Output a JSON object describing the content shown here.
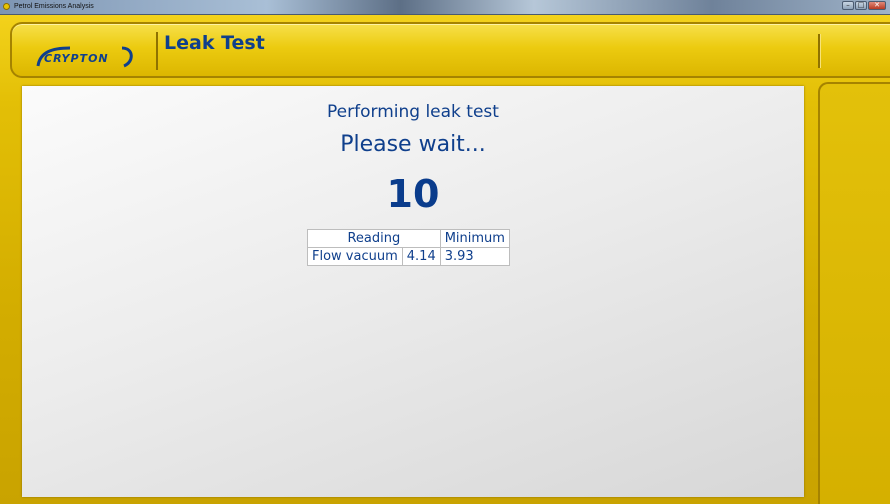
{
  "window": {
    "title": "Petrol Emissions Analysis",
    "controls": {
      "minimize": "–",
      "maximize": "□",
      "close": "✕"
    }
  },
  "header": {
    "logo_text": "CRYPTON",
    "title": "Leak Test"
  },
  "main": {
    "status_line_1": "Performing leak test",
    "status_line_2": "Please wait...",
    "countdown": "10",
    "table": {
      "headers": [
        "Reading",
        "Minimum"
      ],
      "rows": [
        {
          "label": "Flow vacuum",
          "reading": "4.14",
          "minimum": "3.93"
        }
      ]
    }
  },
  "colors": {
    "frame_yellow": "#e3bf06",
    "title_blue": "#0f3f8c",
    "panel_grey": "#e6e6e6"
  }
}
